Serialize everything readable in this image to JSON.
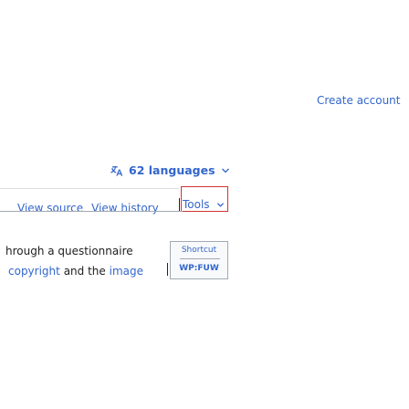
{
  "header": {
    "create_account": "Create account"
  },
  "languages": {
    "label": "62 languages",
    "icon": "language-icon",
    "chevron": "chevron-down-icon"
  },
  "tabs": {
    "view_source": "View source",
    "view_history": "View history",
    "tools": "Tools"
  },
  "content": {
    "line1": "hrough a questionnaire",
    "line2_part1": "copyright",
    "line2_part2": "and the",
    "line2_part3": "image"
  },
  "shortcut_box": {
    "title": "Shortcut",
    "value": "WP:FUW"
  },
  "colors": {
    "link": "#3366cc",
    "text": "#202122",
    "tools_border": "#d33333",
    "border": "#a2a9b1"
  }
}
